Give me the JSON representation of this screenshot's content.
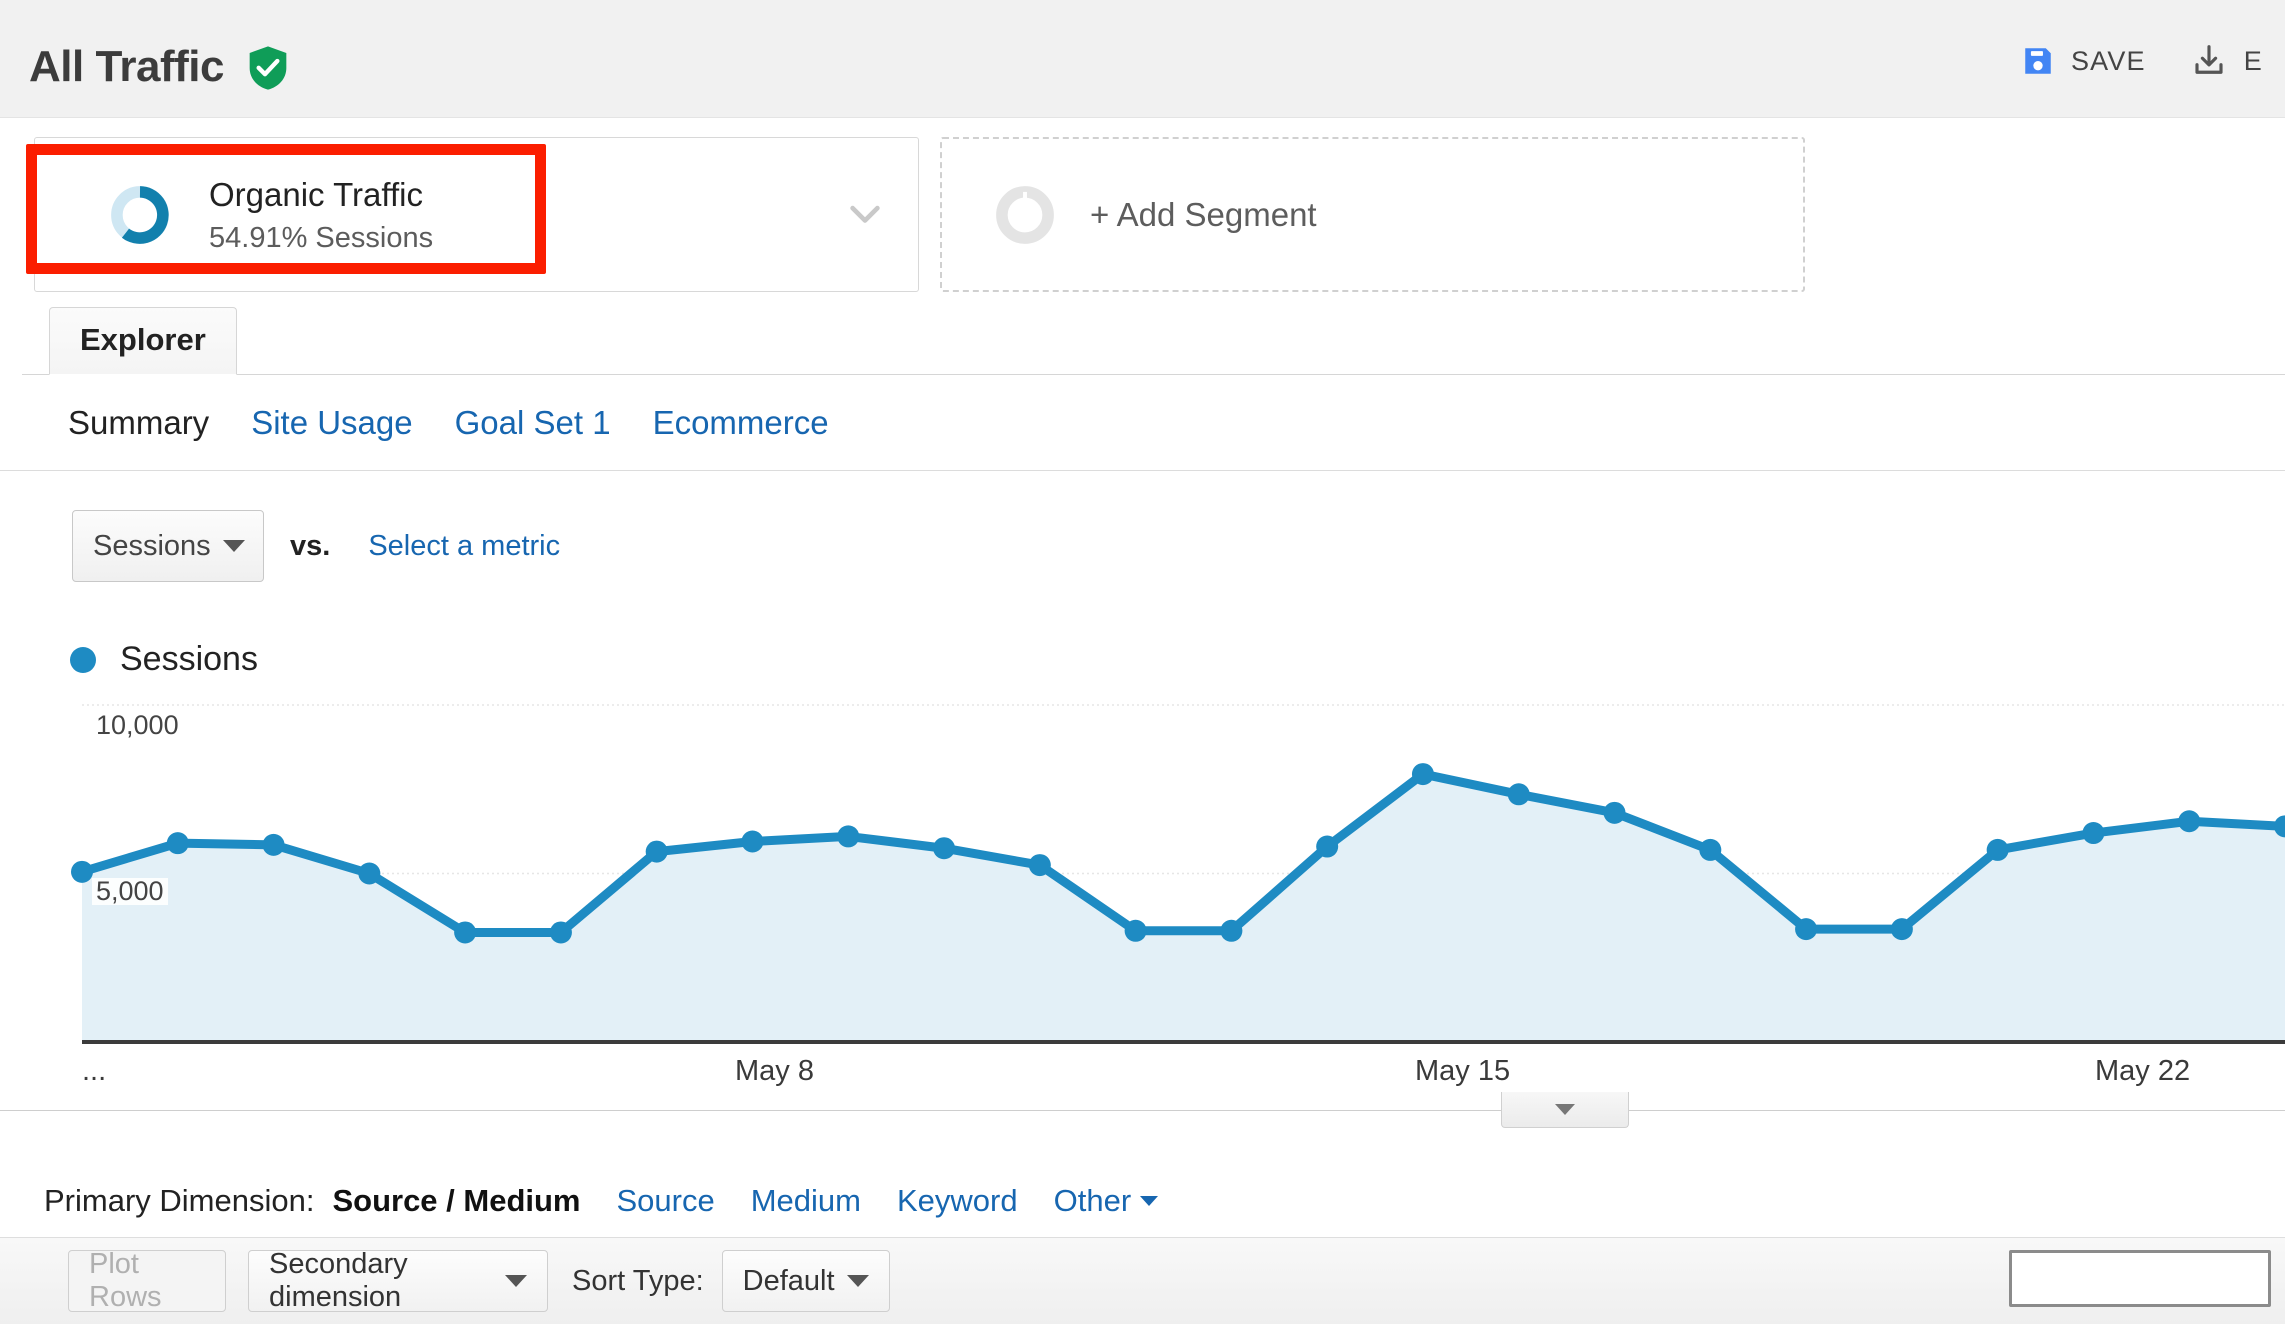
{
  "header": {
    "title": "All Traffic",
    "verified_icon": "shield-check-icon",
    "actions": [
      {
        "label": "SAVE",
        "icon": "save-floppy-icon"
      },
      {
        "label": "E",
        "icon": "export-download-icon"
      }
    ]
  },
  "segments": {
    "applied": {
      "name": "Organic Traffic",
      "subtitle": "54.91% Sessions",
      "donut_icon": "donut-chart-icon",
      "chevron_icon": "chevron-down-icon"
    },
    "add_segment": {
      "label": "+ Add Segment",
      "donut_icon": "donut-chart-outline-icon"
    }
  },
  "tabs": {
    "primary": [
      {
        "label": "Explorer",
        "active": true
      }
    ],
    "sub": [
      {
        "label": "Summary",
        "active": true
      },
      {
        "label": "Site Usage",
        "active": false
      },
      {
        "label": "Goal Set 1",
        "active": false
      },
      {
        "label": "Ecommerce",
        "active": false
      }
    ]
  },
  "metric_selector": {
    "selected": "Sessions",
    "vs": "vs.",
    "compare_link": "Select a metric",
    "caret_icon": "caret-down-icon"
  },
  "legend": {
    "series_label": "Sessions",
    "dot_color": "#1e8bc3"
  },
  "chart_controls": {
    "toggle_icon": "caret-down-icon"
  },
  "primary_dimension": {
    "label": "Primary Dimension:",
    "active": "Source / Medium",
    "links": [
      "Source",
      "Medium",
      "Keyword"
    ],
    "other": "Other",
    "other_caret_icon": "caret-down-icon"
  },
  "bottom_toolbar": {
    "plot_rows": "Plot Rows",
    "secondary_dimension": "Secondary dimension",
    "sort_type_label": "Sort Type:",
    "sort_type_value": "Default",
    "search_value": "",
    "search_placeholder": "",
    "caret_icon": "caret-down-icon"
  },
  "colors": {
    "accent_blue": "#1e8bc3",
    "link_blue": "#1766b0",
    "area_fill": "#e3f0f7",
    "annotation_red": "#fb1e00",
    "verified_green": "#0f9d58",
    "save_blue": "#4285f4"
  },
  "chart_data": {
    "type": "area",
    "title": "",
    "xlabel": "",
    "ylabel": "Sessions",
    "grid": true,
    "legend_position": "top-left",
    "ylim": [
      0,
      10000
    ],
    "yticks": [
      5000,
      10000
    ],
    "ytick_labels": [
      "5,000",
      "10,000"
    ],
    "xtick_labels": [
      "...",
      "May 8",
      "May 15",
      "May 22"
    ],
    "series": [
      {
        "name": "Sessions",
        "color": "#1e8bc3",
        "values": [
          5050,
          5900,
          5850,
          5000,
          3250,
          3250,
          5650,
          5950,
          6100,
          5750,
          5250,
          3300,
          3300,
          5800,
          7950,
          7350,
          6800,
          5700,
          3350,
          3350,
          5700,
          6200,
          6550,
          6400
        ]
      }
    ]
  }
}
